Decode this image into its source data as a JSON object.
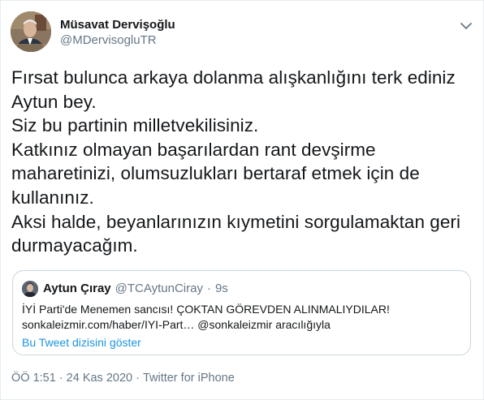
{
  "author": {
    "display_name": "Müsavat Dervişoğlu",
    "handle": "@MDervisogluTR"
  },
  "tweet": {
    "lines": [
      "Fırsat bulunca arkaya dolanma alışkanlığını terk ediniz",
      "Aytun bey.",
      "Siz bu partinin milletvekilisiniz.",
      "Katkınız olmayan başarılardan rant devşirme",
      "maharetinizi, olumsuzlukları bertaraf etmek için de",
      "kullanınız.",
      "Aksi halde, beyanlarınızın kıymetini sorgulamaktan geri",
      "durmayacağım."
    ]
  },
  "quoted": {
    "display_name": "Aytun Çıray",
    "handle": "@TCAytunCiray",
    "dot": "·",
    "time": "9s",
    "lines": [
      "İYİ Parti'de Menemen sancısı! ÇOKTAN GÖREVDEN ALINMALIYDILAR!",
      "sonkaleizmir.com/haber/IYI-Part… @sonkaleizmir aracılığıyla"
    ],
    "thread_link": "Bu Tweet dizisini göster"
  },
  "meta": {
    "time": "ÖÖ 1:51",
    "separator": "·",
    "date": "24 Kas 2020",
    "source": "Twitter for iPhone"
  },
  "icons": {
    "caret": "chevron-down-icon"
  },
  "colors": {
    "link": "#1b95e0",
    "secondary_text": "#657786",
    "border": "#ccd6dd"
  }
}
